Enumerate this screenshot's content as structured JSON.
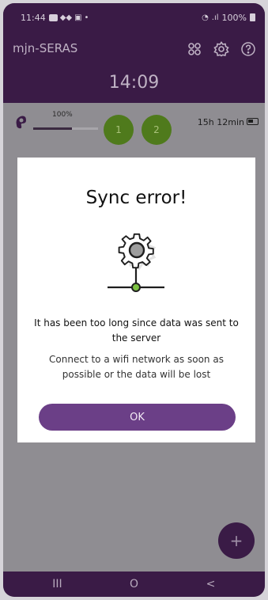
{
  "status_bar": {
    "time": "11:44",
    "battery_text": "100%"
  },
  "header": {
    "app_title": "mjn-SERAS",
    "clock": "14:09"
  },
  "device": {
    "battery_percent_label": "100%",
    "battery_level": 0.6,
    "slots": [
      "1",
      "2"
    ],
    "remaining_time": "15h 12min"
  },
  "dialog": {
    "title": "Sync error!",
    "message_main": "It has been too long since data was sent to the server",
    "message_sub": "Connect to a wifi network as soon as possible or the data will be lost",
    "ok_label": "OK"
  },
  "fab": {
    "label": "+"
  },
  "nav": {
    "recent": "III",
    "home": "O",
    "back": "<"
  },
  "colors": {
    "brand": "#3a1b46",
    "accent": "#6b3f87",
    "green": "#4f7a1c",
    "connector": "#7cc242"
  }
}
